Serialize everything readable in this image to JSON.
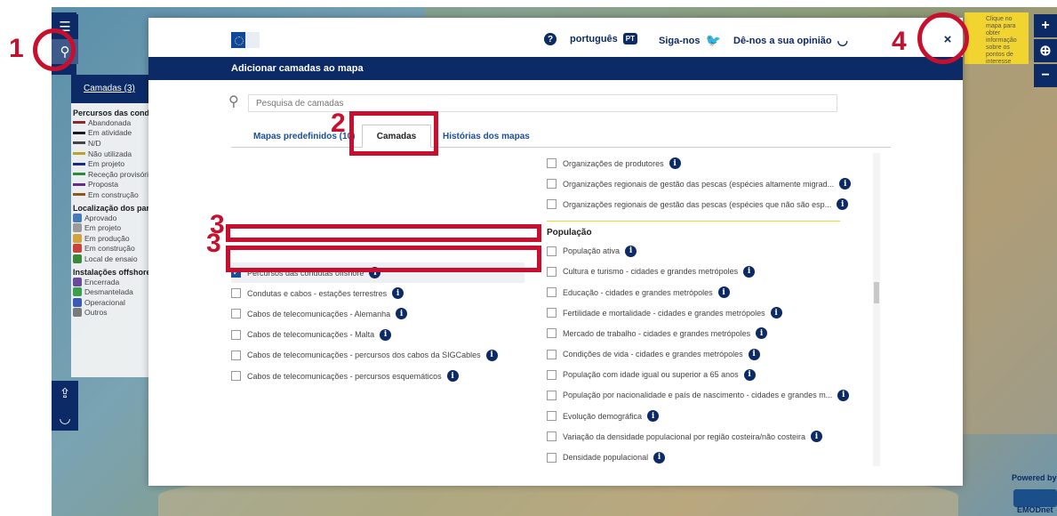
{
  "colors": {
    "navy": "#0c2a66",
    "annotation_red": "#c8102e",
    "accent_yellow": "#f2d431"
  },
  "sidebar": {
    "layers_tab": "Camadas (3)",
    "groups": [
      {
        "title": "Percursos das condu",
        "items": [
          {
            "label": "Abandonada",
            "color": "#8b2a2a"
          },
          {
            "label": "Em atividade",
            "color": "#1a1a1a"
          },
          {
            "label": "N/D",
            "color": "#444444"
          },
          {
            "label": "Não utilizada",
            "color": "#b5a52a"
          },
          {
            "label": "Em projeto",
            "color": "#1a2a8b"
          },
          {
            "label": "Receção provisória",
            "color": "#2a8b3a"
          },
          {
            "label": "Proposta",
            "color": "#6a2a8b"
          },
          {
            "label": "Em construção",
            "color": "#8b5a1a"
          }
        ]
      },
      {
        "title": "Localização dos parq",
        "items": [
          {
            "label": "Aprovado",
            "color": "#4a7ab5"
          },
          {
            "label": "Em projeto",
            "color": "#9a9a9a"
          },
          {
            "label": "Em produção",
            "color": "#d4a23a"
          },
          {
            "label": "Em construção",
            "color": "#c8443a"
          },
          {
            "label": "Local de ensaio",
            "color": "#3a8a3a"
          }
        ]
      },
      {
        "title": "Instalações offshore",
        "items": [
          {
            "label": "Encerrada",
            "color": "#6a4a9a"
          },
          {
            "label": "Desmantelada",
            "color": "#3aa04a"
          },
          {
            "label": "Operacional",
            "color": "#3a5ab5"
          },
          {
            "label": "Outros",
            "color": "#7a7a7a"
          }
        ]
      }
    ]
  },
  "map_tools": {
    "menu_icon": "menu-icon",
    "search_icon": "search-icon",
    "share_icon": "share-icon",
    "feedback_icon": "smile-icon"
  },
  "map_controls": {
    "zoom_in": "+",
    "locate": "⊕",
    "zoom_out": "−"
  },
  "tooltip": "Clique no mapa para obter informação sobre os pontos de interesse",
  "powered_by": "Powered by",
  "emodnet": "EMODnet",
  "modal": {
    "top_bar": {
      "help_icon": "?",
      "language": "português",
      "language_code": "PT",
      "follow": "Siga-nos",
      "feedback": "Dê-nos a sua opinião",
      "close": "×"
    },
    "title": "Adicionar camadas ao mapa",
    "search_placeholder": "Pesquisa de camadas",
    "tabs": [
      "Mapas predefinidos (10)",
      "Camadas",
      "Histórias dos mapas"
    ],
    "left_column": [
      {
        "label": "Percursos das condutas offshore",
        "checked": true,
        "info": true
      },
      {
        "label": "Condutas e cabos - estações terrestres",
        "checked": false,
        "info": true
      },
      {
        "label": "Cabos de telecomunicações - Alemanha",
        "checked": false,
        "info": true
      },
      {
        "label": "Cabos de telecomunicações - Malta",
        "checked": false,
        "info": true
      },
      {
        "label": "Cabos de telecomunicações - percursos dos cabos da SIGCables",
        "checked": false,
        "info": true
      },
      {
        "label": "Cabos de telecomunicações - percursos esquemáticos",
        "checked": false,
        "info": true
      }
    ],
    "right_column_top": [
      {
        "label": "Organizações de produtores",
        "checked": false,
        "info": true
      },
      {
        "label": "Organizações regionais de gestão das pescas (espécies altamente migrad...",
        "checked": false,
        "info": true
      },
      {
        "label": "Organizações regionais de gestão das pescas (espécies que não são esp...",
        "checked": false,
        "info": true
      }
    ],
    "right_group_title": "População",
    "right_column_bottom": [
      {
        "label": "População ativa",
        "checked": false,
        "info": true
      },
      {
        "label": "Cultura e turismo - cidades e grandes metrópoles",
        "checked": false,
        "info": true
      },
      {
        "label": "Educação - cidades e grandes metrópoles",
        "checked": false,
        "info": true
      },
      {
        "label": "Fertilidade e mortalidade - cidades e grandes metrópoles",
        "checked": false,
        "info": true
      },
      {
        "label": "Mercado de trabalho - cidades e grandes metrópoles",
        "checked": false,
        "info": true
      },
      {
        "label": "Condições de vida - cidades e grandes metrópoles",
        "checked": false,
        "info": true
      },
      {
        "label": "População com idade igual ou superior a 65 anos",
        "checked": false,
        "info": true
      },
      {
        "label": "População por nacionalidade e país de nascimento - cidades e grandes m...",
        "checked": false,
        "info": true
      },
      {
        "label": "Evolução demográfica",
        "checked": false,
        "info": true
      },
      {
        "label": "Variação da densidade populacional por região costeira/não costeira",
        "checked": false,
        "info": true
      },
      {
        "label": "Densidade populacional",
        "checked": false,
        "info": true
      }
    ]
  },
  "annotations": [
    "1",
    "2",
    "3",
    "3",
    "4"
  ]
}
